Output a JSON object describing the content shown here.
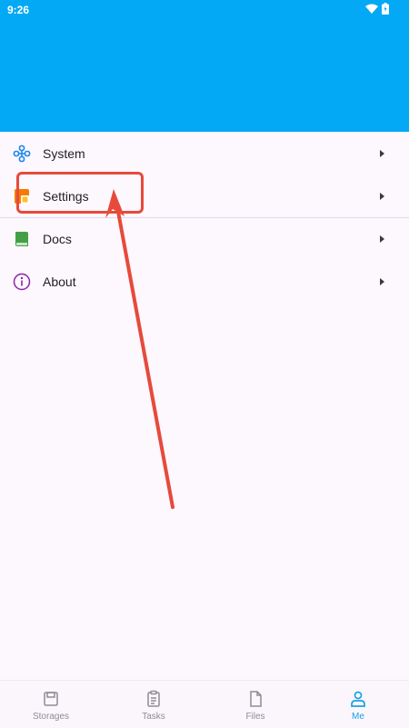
{
  "status": {
    "time": "9:26",
    "icons": [
      "wifi-icon",
      "battery-icon"
    ]
  },
  "header": {
    "color": "#03a9f4"
  },
  "menu": {
    "items": [
      {
        "label": "System",
        "icon": "system-icon",
        "icon_color": "#1e88e5"
      },
      {
        "label": "Settings",
        "icon": "settings-icon",
        "icon_color": "#f57c00"
      },
      {
        "label": "Docs",
        "icon": "book-icon",
        "icon_color": "#43a047"
      },
      {
        "label": "About",
        "icon": "info-icon",
        "icon_color": "#8e24aa"
      }
    ]
  },
  "annotation": {
    "color": "#e64a3b",
    "target": "Settings"
  },
  "bottom_nav": {
    "items": [
      {
        "label": "Storages",
        "icon": "storage-icon"
      },
      {
        "label": "Tasks",
        "icon": "clipboard-icon"
      },
      {
        "label": "Files",
        "icon": "file-icon"
      },
      {
        "label": "Me",
        "icon": "person-icon"
      }
    ],
    "active": "Me",
    "active_color": "#1aa1e6",
    "inactive_color": "#8e8b94"
  }
}
